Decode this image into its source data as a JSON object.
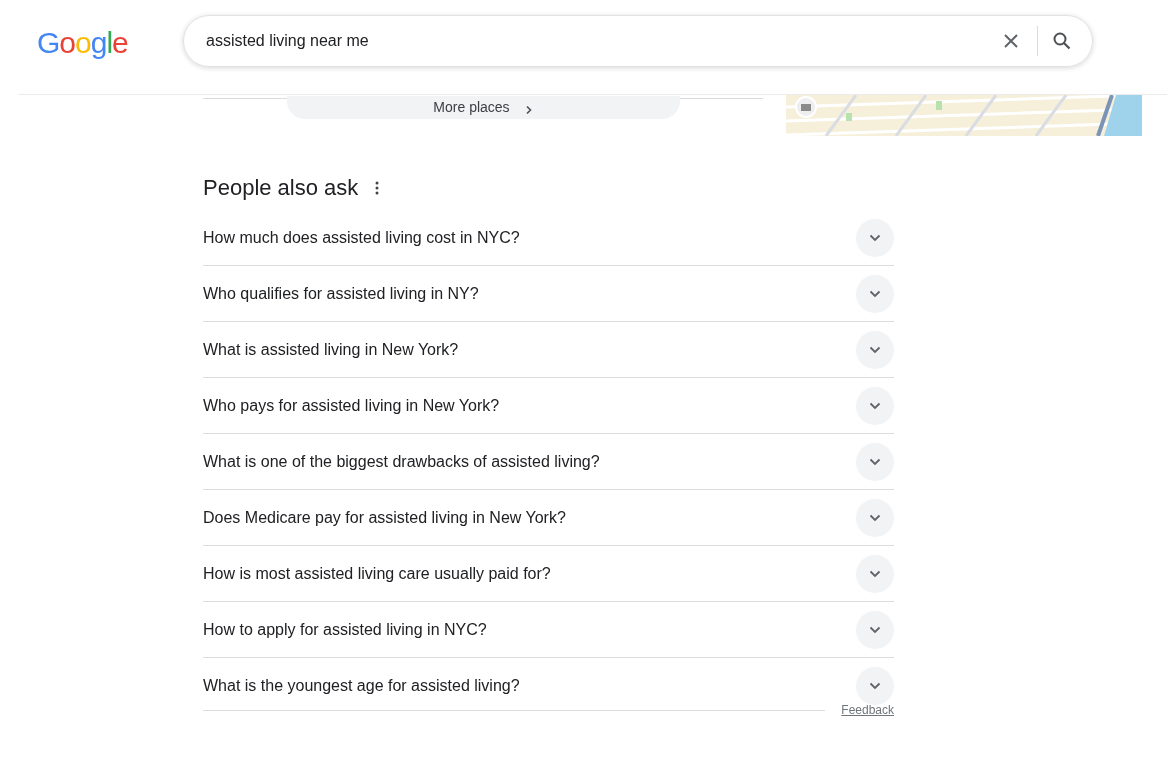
{
  "logo": "Google",
  "search": {
    "value": "assisted living near me"
  },
  "more_places": {
    "label": "More places"
  },
  "people_also_ask": {
    "title": "People also ask",
    "questions": [
      {
        "text": "How much does assisted living cost in NYC?",
        "expanded": false
      },
      {
        "text": "Who qualifies for assisted living in NY?",
        "expanded": false
      },
      {
        "text": "What is assisted living in New York?",
        "expanded": false
      },
      {
        "text": "Who pays for assisted living in New York?",
        "expanded": false
      },
      {
        "text": "What is one of the biggest drawbacks of assisted living?",
        "expanded": false
      },
      {
        "text": "Does Medicare pay for assisted living in New York?",
        "expanded": false
      },
      {
        "text": "How is most assisted living care usually paid for?",
        "expanded": false
      },
      {
        "text": "How to apply for assisted living in NYC?",
        "expanded": false
      },
      {
        "text": "What is the youngest age for assisted living?",
        "expanded": false
      }
    ]
  },
  "feedback": "Feedback"
}
